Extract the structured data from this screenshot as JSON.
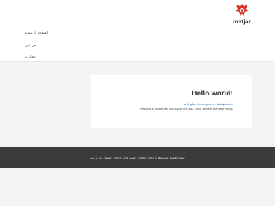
{
  "header": {
    "logo_text": "matjar"
  },
  "nav": {
    "items": [
      {
        "label": "الصفحة الرئيسية"
      },
      {
        "label": "من نحن"
      },
      {
        "label": "اتصل بنا"
      }
    ]
  },
  "post": {
    "title": "Hello world!",
    "meta": "تعليق واحد / Uncategorized / بواسطة admin",
    "excerpt": "Welcome to WordPress. This is your first post. Edit or delete it, then start writing!"
  },
  "footer": {
    "copyright": "جميع الحقوق محفوظة © 2024 matjar | تطوير قالب Astra | تشغيل ووردبريس"
  },
  "colors": {
    "background": "#f4f4f4",
    "footer_bg": "#3b3b3b",
    "link": "#2b72b5",
    "logo_red": "#d6342c"
  }
}
